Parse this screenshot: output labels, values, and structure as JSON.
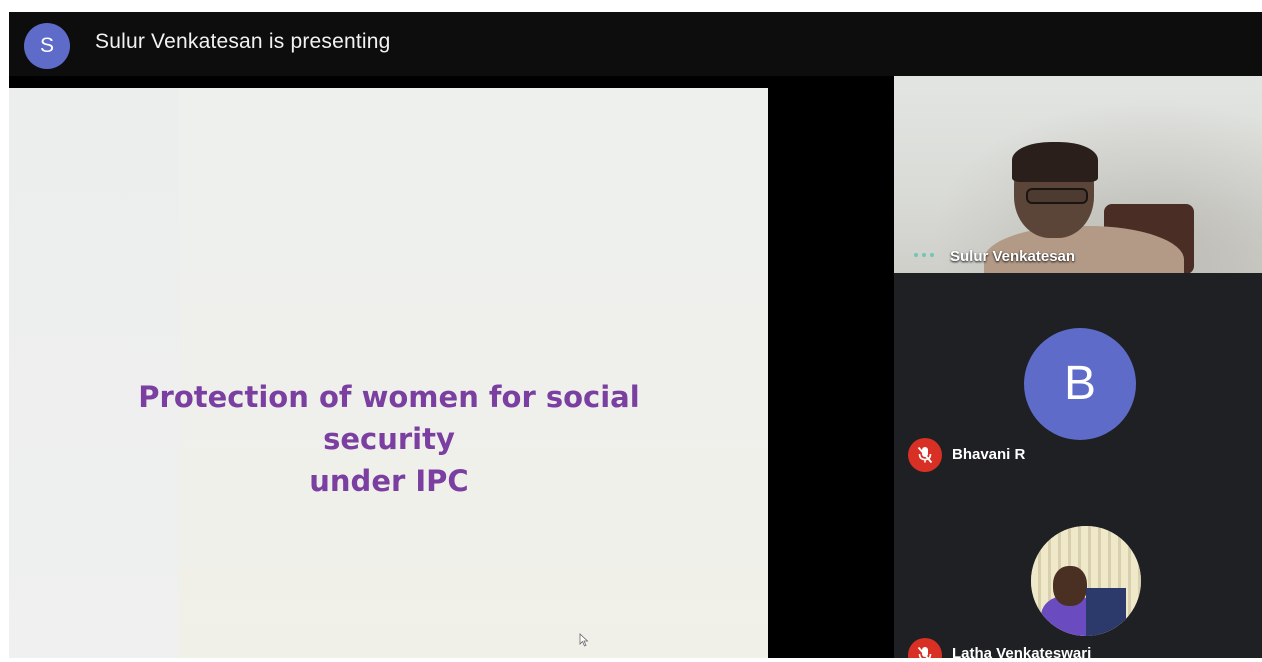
{
  "header": {
    "presenter_initial": "S",
    "presenting_text": "Sulur Venkatesan is presenting"
  },
  "slide": {
    "title_line1": "Protection of women for social security",
    "title_line2": "under IPC"
  },
  "participants": [
    {
      "name": "Sulur Venkatesan",
      "video": "camera",
      "status": "speaking"
    },
    {
      "name": "Bhavani R",
      "initial": "B",
      "mic": "muted"
    },
    {
      "name": "Latha Venkateswari",
      "video": "photo",
      "mic": "muted"
    }
  ],
  "colors": {
    "avatar": "#5f6bc9",
    "muted": "#d93025",
    "slide_title": "#7a3fa0",
    "panel": "#1f2024"
  },
  "icons": [
    "mic-off-icon",
    "speaking-dots-icon",
    "cursor-icon"
  ]
}
